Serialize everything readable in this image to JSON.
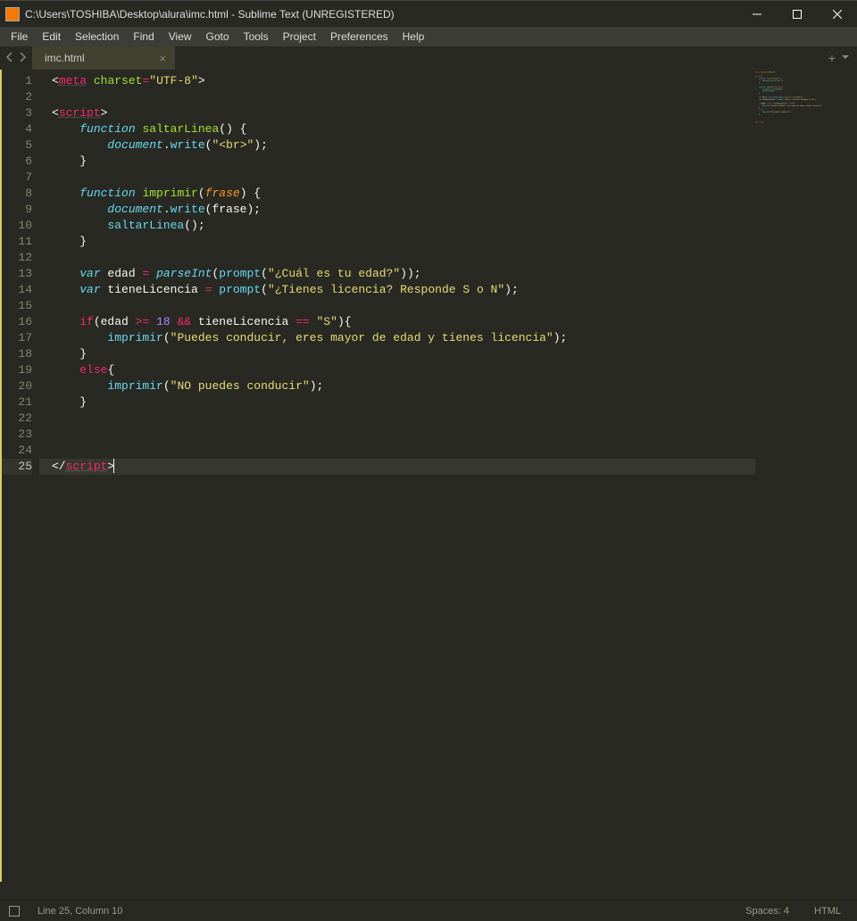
{
  "window": {
    "title": "C:\\Users\\TOSHIBA\\Desktop\\alura\\imc.html - Sublime Text (UNREGISTERED)"
  },
  "menu": [
    "File",
    "Edit",
    "Selection",
    "Find",
    "View",
    "Goto",
    "Tools",
    "Project",
    "Preferences",
    "Help"
  ],
  "tabs": [
    {
      "label": "imc.html",
      "active": true
    }
  ],
  "gutter": {
    "first": 1,
    "last": 25,
    "current": 25
  },
  "code": {
    "lines": [
      [
        [
          "c-punct",
          "<"
        ],
        [
          "c-tag",
          "meta"
        ],
        [
          "c-punct",
          " "
        ],
        [
          "c-attr",
          "charset"
        ],
        [
          "c-op",
          "="
        ],
        [
          "c-str",
          "\"UTF-8\""
        ],
        [
          "c-punct",
          ">"
        ]
      ],
      [],
      [
        [
          "c-punct",
          "<"
        ],
        [
          "c-tag",
          "script"
        ],
        [
          "c-punct",
          ">"
        ]
      ],
      [
        [
          "c-punct",
          "    "
        ],
        [
          "c-kw",
          "function"
        ],
        [
          "c-punct",
          " "
        ],
        [
          "c-fn",
          "saltarLinea"
        ],
        [
          "c-punct",
          "() {"
        ]
      ],
      [
        [
          "c-punct",
          "        "
        ],
        [
          "c-obj",
          "document"
        ],
        [
          "c-punct",
          "."
        ],
        [
          "c-call",
          "write"
        ],
        [
          "c-punct",
          "("
        ],
        [
          "c-str",
          "\"<br>\""
        ],
        [
          "c-punct",
          ");"
        ]
      ],
      [
        [
          "c-punct",
          "    }"
        ]
      ],
      [],
      [
        [
          "c-punct",
          "    "
        ],
        [
          "c-kw",
          "function"
        ],
        [
          "c-punct",
          " "
        ],
        [
          "c-fn",
          "imprimir"
        ],
        [
          "c-punct",
          "("
        ],
        [
          "c-param",
          "frase"
        ],
        [
          "c-punct",
          ") {"
        ]
      ],
      [
        [
          "c-punct",
          "        "
        ],
        [
          "c-obj",
          "document"
        ],
        [
          "c-punct",
          "."
        ],
        [
          "c-call",
          "write"
        ],
        [
          "c-punct",
          "(frase);"
        ]
      ],
      [
        [
          "c-punct",
          "        "
        ],
        [
          "c-call",
          "saltarLinea"
        ],
        [
          "c-punct",
          "();"
        ]
      ],
      [
        [
          "c-punct",
          "    }"
        ]
      ],
      [],
      [
        [
          "c-punct",
          "    "
        ],
        [
          "c-kw",
          "var"
        ],
        [
          "c-punct",
          " edad "
        ],
        [
          "c-op",
          "="
        ],
        [
          "c-punct",
          " "
        ],
        [
          "c-obj",
          "parseInt"
        ],
        [
          "c-punct",
          "("
        ],
        [
          "c-call",
          "prompt"
        ],
        [
          "c-punct",
          "("
        ],
        [
          "c-str",
          "\"¿Cuál es tu edad?\""
        ],
        [
          "c-punct",
          "));"
        ]
      ],
      [
        [
          "c-punct",
          "    "
        ],
        [
          "c-kw",
          "var"
        ],
        [
          "c-punct",
          " tieneLicencia "
        ],
        [
          "c-op",
          "="
        ],
        [
          "c-punct",
          " "
        ],
        [
          "c-call",
          "prompt"
        ],
        [
          "c-punct",
          "("
        ],
        [
          "c-str",
          "\"¿Tienes licencia? Responde S o N\""
        ],
        [
          "c-punct",
          ");"
        ]
      ],
      [],
      [
        [
          "c-punct",
          "    "
        ],
        [
          "c-kw2",
          "if"
        ],
        [
          "c-punct",
          "(edad "
        ],
        [
          "c-op",
          ">="
        ],
        [
          "c-punct",
          " "
        ],
        [
          "c-num",
          "18"
        ],
        [
          "c-punct",
          " "
        ],
        [
          "c-op",
          "&&"
        ],
        [
          "c-punct",
          " tieneLicencia "
        ],
        [
          "c-op",
          "=="
        ],
        [
          "c-punct",
          " "
        ],
        [
          "c-str",
          "\"S\""
        ],
        [
          "c-punct",
          "){"
        ]
      ],
      [
        [
          "c-punct",
          "        "
        ],
        [
          "c-call",
          "imprimir"
        ],
        [
          "c-punct",
          "("
        ],
        [
          "c-str",
          "\"Puedes conducir, eres mayor de edad y tienes licencia\""
        ],
        [
          "c-punct",
          ");"
        ]
      ],
      [
        [
          "c-punct",
          "    }"
        ]
      ],
      [
        [
          "c-punct",
          "    "
        ],
        [
          "c-kw2",
          "else"
        ],
        [
          "c-punct",
          "{"
        ]
      ],
      [
        [
          "c-punct",
          "        "
        ],
        [
          "c-call",
          "imprimir"
        ],
        [
          "c-punct",
          "("
        ],
        [
          "c-str",
          "\"NO puedes conducir\""
        ],
        [
          "c-punct",
          ");"
        ]
      ],
      [
        [
          "c-punct",
          "    }"
        ]
      ],
      [],
      [],
      [],
      [
        [
          "c-punct",
          "</"
        ],
        [
          "c-tag",
          "script"
        ],
        [
          "c-punct",
          ">"
        ]
      ]
    ],
    "cursor_line": 25
  },
  "status": {
    "position": "Line 25, Column 10",
    "spaces": "Spaces: 4",
    "syntax": "HTML"
  }
}
